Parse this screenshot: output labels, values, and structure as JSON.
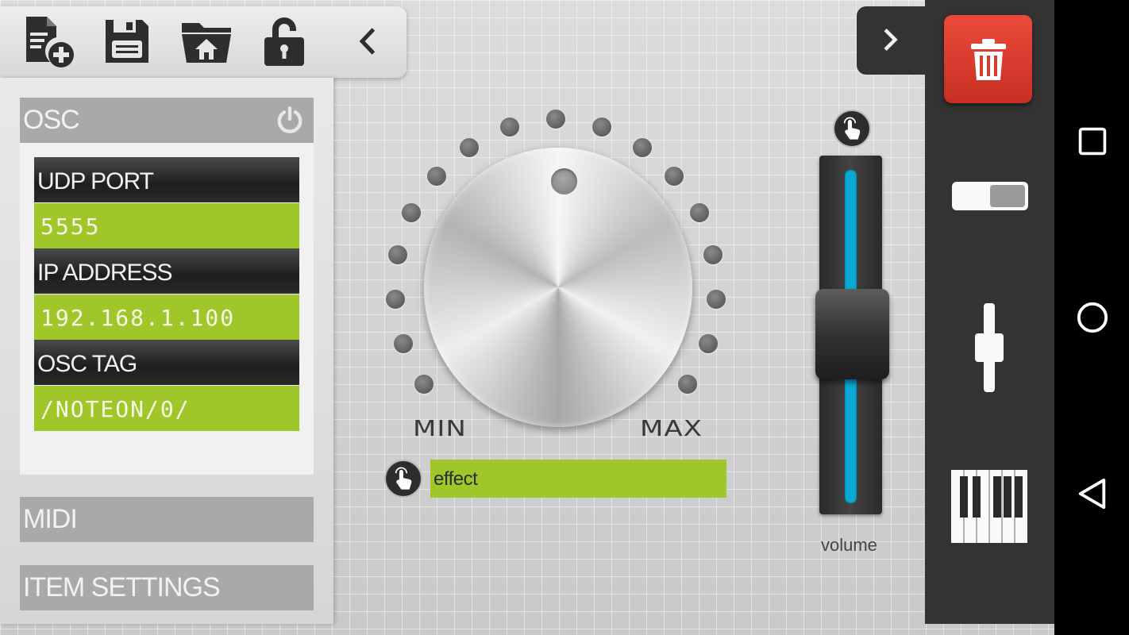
{
  "toolbar": {
    "icons": [
      "new-file-icon",
      "save-icon",
      "open-folder-icon",
      "lock-icon",
      "chevron-left-icon"
    ]
  },
  "left_panel": {
    "osc": {
      "title": "OSC",
      "fields": [
        {
          "label": "UDP PORT",
          "value": "5555"
        },
        {
          "label": "IP ADDRESS",
          "value": "192.168.1.100"
        },
        {
          "label": "OSC TAG",
          "value": "/NOTEON/0/"
        }
      ]
    },
    "midi": {
      "title": "MIDI"
    },
    "item_settings": {
      "title": "ITEM SETTINGS"
    }
  },
  "knob": {
    "min_label": "MIN",
    "max_label": "MAX",
    "name": "effect"
  },
  "slider": {
    "label": "volume"
  },
  "right_panel": {
    "icons": [
      "trash-icon",
      "toggle-switch-icon",
      "slider-icon",
      "piano-keyboard-icon",
      "chevron-right-icon"
    ]
  },
  "navbar": {
    "icons": [
      "recents-square-icon",
      "home-circle-icon",
      "back-triangle-icon"
    ]
  },
  "colors": {
    "accent_green": "#9fc72a",
    "slider_blue": "#0aa8d4",
    "delete_red": "#d63c2e",
    "dark_panel": "#333333"
  }
}
